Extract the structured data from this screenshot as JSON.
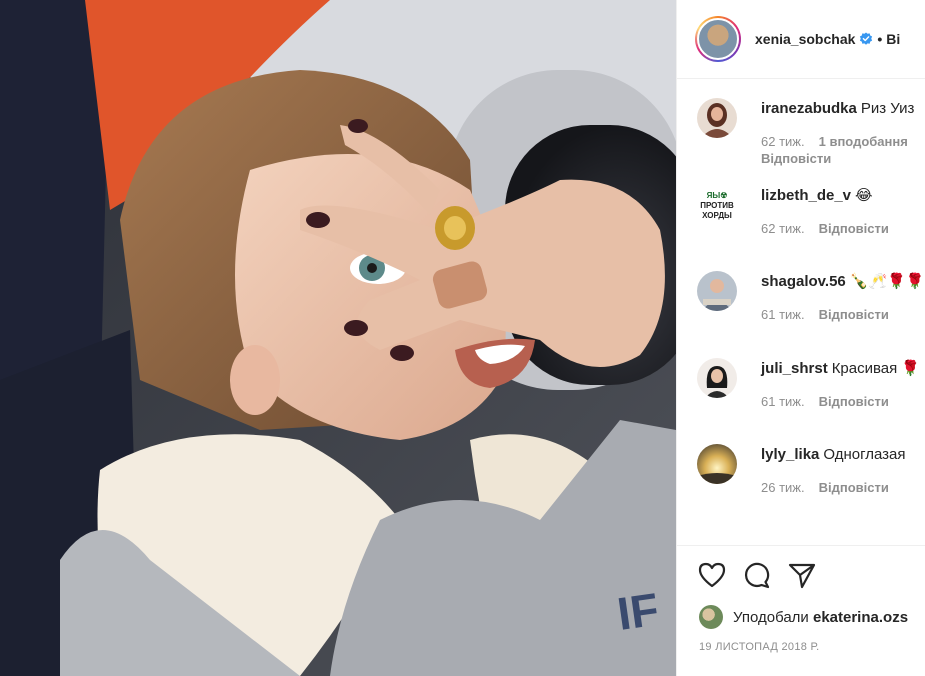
{
  "post": {
    "owner": "xenia_sobchak",
    "separator": "•",
    "follow_label": "Ві",
    "photo_alt": ""
  },
  "comments": [
    {
      "user": "iranezabudka",
      "text": "Риз Уиз",
      "time": "62 тиж.",
      "likes": "1 вподобання",
      "reply": "Відповісти",
      "avatar_color": "#7a4a3a"
    },
    {
      "user": "lizbeth_de_v",
      "text": "😂",
      "time": "62 тиж.",
      "likes": "",
      "reply": "Відповісти",
      "avatar_color": "#ffffff",
      "avatar_text": "ЯЫ ПРОТИВ ХОРДЫ"
    },
    {
      "user": "shagalov.56",
      "text": "🍾🥂🌹🌹",
      "time": "61 тиж.",
      "likes": "",
      "reply": "Відповісти",
      "avatar_color": "#8b95a4"
    },
    {
      "user": "juli_shrst",
      "text": "Красивая 🌹",
      "time": "61 тиж.",
      "likes": "",
      "reply": "Відповісти",
      "avatar_color": "#f1ece8"
    },
    {
      "user": "lyly_lika",
      "text": "Одноглазая",
      "time": "26 тиж.",
      "likes": "",
      "reply": "Відповісти",
      "avatar_color": "#c8a24a"
    }
  ],
  "actions": {
    "icons": [
      "heart-icon",
      "comment-icon",
      "share-icon"
    ],
    "liked_prefix": "Уподобали",
    "liked_user": "ekaterina.ozs",
    "date": "19 ЛИСТОПАД 2018 Р."
  },
  "colors": {
    "text": "#262626",
    "muted": "#8e8e8e",
    "verified": "#3897f0",
    "border": "#efefef"
  }
}
